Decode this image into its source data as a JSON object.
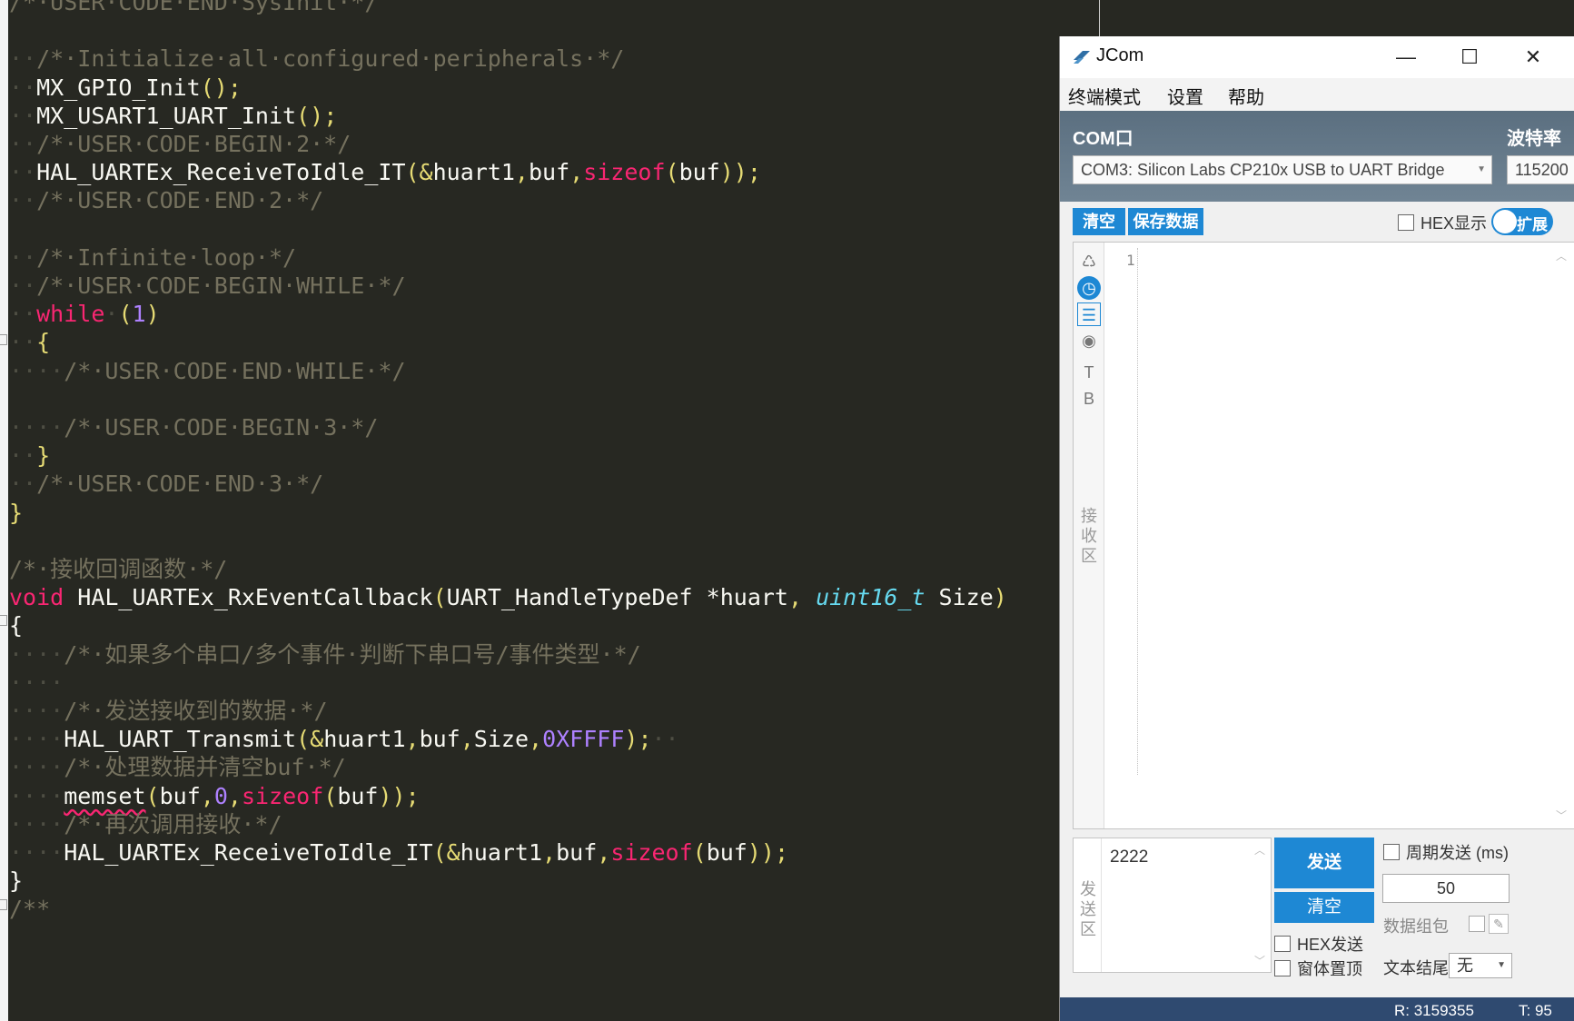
{
  "editor": {
    "lines": [
      [
        {
          "t": "/*·USER·CODE·END·SysInit·*/",
          "c": "comment"
        }
      ],
      [],
      [
        {
          "t": "··",
          "c": "ws"
        },
        {
          "t": "/*·Initialize·all·configured·peripherals·*/",
          "c": "comment"
        }
      ],
      [
        {
          "t": "··",
          "c": "ws"
        },
        {
          "t": "MX_GPIO_Init",
          "c": "plain"
        },
        {
          "t": "();",
          "c": "paren"
        }
      ],
      [
        {
          "t": "··",
          "c": "ws"
        },
        {
          "t": "MX_USART1_UART_Init",
          "c": "plain"
        },
        {
          "t": "();",
          "c": "paren"
        }
      ],
      [
        {
          "t": "··",
          "c": "ws"
        },
        {
          "t": "/*·USER·CODE·BEGIN·2·*/",
          "c": "comment"
        }
      ],
      [
        {
          "t": "··",
          "c": "ws"
        },
        {
          "t": "HAL_UARTEx_ReceiveToIdle_IT",
          "c": "plain"
        },
        {
          "t": "(&",
          "c": "paren"
        },
        {
          "t": "huart1",
          "c": "plain"
        },
        {
          "t": ",",
          "c": "paren"
        },
        {
          "t": "buf",
          "c": "plain"
        },
        {
          "t": ",",
          "c": "paren"
        },
        {
          "t": "sizeof",
          "c": "keyword"
        },
        {
          "t": "(",
          "c": "paren"
        },
        {
          "t": "buf",
          "c": "plain"
        },
        {
          "t": "));",
          "c": "paren"
        }
      ],
      [
        {
          "t": "··",
          "c": "ws"
        },
        {
          "t": "/*·USER·CODE·END·2·*/",
          "c": "comment"
        }
      ],
      [],
      [
        {
          "t": "··",
          "c": "ws"
        },
        {
          "t": "/*·Infinite·loop·*/",
          "c": "comment"
        }
      ],
      [
        {
          "t": "··",
          "c": "ws"
        },
        {
          "t": "/*·USER·CODE·BEGIN·WHILE·*/",
          "c": "comment"
        }
      ],
      [
        {
          "t": "··",
          "c": "ws"
        },
        {
          "t": "while",
          "c": "keyword"
        },
        {
          "t": "·",
          "c": "ws"
        },
        {
          "t": "(",
          "c": "paren"
        },
        {
          "t": "1",
          "c": "number"
        },
        {
          "t": ")",
          "c": "paren"
        }
      ],
      [
        {
          "t": "··",
          "c": "ws"
        },
        {
          "t": "{",
          "c": "paren"
        }
      ],
      [
        {
          "t": "····",
          "c": "ws"
        },
        {
          "t": "/*·USER·CODE·END·WHILE·*/",
          "c": "comment"
        }
      ],
      [],
      [
        {
          "t": "····",
          "c": "ws"
        },
        {
          "t": "/*·USER·CODE·BEGIN·3·*/",
          "c": "comment"
        }
      ],
      [
        {
          "t": "··",
          "c": "ws"
        },
        {
          "t": "}",
          "c": "paren"
        }
      ],
      [
        {
          "t": "··",
          "c": "ws"
        },
        {
          "t": "/*·USER·CODE·END·3·*/",
          "c": "comment"
        }
      ],
      [
        {
          "t": "}",
          "c": "paren"
        }
      ],
      [],
      [
        {
          "t": "/*·接收回调函数·*/",
          "c": "comment"
        }
      ],
      [
        {
          "t": "void",
          "c": "keyword"
        },
        {
          "t": " HAL_UARTEx_RxEventCallback",
          "c": "plain"
        },
        {
          "t": "(",
          "c": "paren"
        },
        {
          "t": "UART_HandleTypeDef",
          "c": "plain"
        },
        {
          "t": " *huart",
          "c": "plain"
        },
        {
          "t": ", ",
          "c": "paren"
        },
        {
          "t": "uint16_t",
          "c": "type"
        },
        {
          "t": " Size",
          "c": "plain"
        },
        {
          "t": ")",
          "c": "paren"
        }
      ],
      [
        {
          "t": "{",
          "c": "plain"
        }
      ],
      [
        {
          "t": "····",
          "c": "ws"
        },
        {
          "t": "/*·如果多个串口/多个事件·判断下串口号/事件类型·*/",
          "c": "comment"
        }
      ],
      [
        {
          "t": "····",
          "c": "ws"
        }
      ],
      [
        {
          "t": "····",
          "c": "ws"
        },
        {
          "t": "/*·发送接收到的数据·*/",
          "c": "comment"
        }
      ],
      [
        {
          "t": "····",
          "c": "ws"
        },
        {
          "t": "HAL_UART_Transmit",
          "c": "plain"
        },
        {
          "t": "(&",
          "c": "paren"
        },
        {
          "t": "huart1",
          "c": "plain"
        },
        {
          "t": ",",
          "c": "paren"
        },
        {
          "t": "buf",
          "c": "plain"
        },
        {
          "t": ",",
          "c": "paren"
        },
        {
          "t": "Size",
          "c": "plain"
        },
        {
          "t": ",",
          "c": "paren"
        },
        {
          "t": "0XFFFF",
          "c": "number"
        },
        {
          "t": ");",
          "c": "paren"
        },
        {
          "t": "··",
          "c": "ws"
        }
      ],
      [
        {
          "t": "····",
          "c": "ws"
        },
        {
          "t": "/*·处理数据并清空buf·*/",
          "c": "comment"
        }
      ],
      [
        {
          "t": "····",
          "c": "ws"
        },
        {
          "t": "memset",
          "c": "squiggle"
        },
        {
          "t": "(",
          "c": "paren"
        },
        {
          "t": "buf",
          "c": "plain"
        },
        {
          "t": ",",
          "c": "paren"
        },
        {
          "t": "0",
          "c": "number"
        },
        {
          "t": ",",
          "c": "paren"
        },
        {
          "t": "sizeof",
          "c": "keyword"
        },
        {
          "t": "(",
          "c": "paren"
        },
        {
          "t": "buf",
          "c": "plain"
        },
        {
          "t": "));",
          "c": "paren"
        }
      ],
      [
        {
          "t": "····",
          "c": "ws"
        },
        {
          "t": "/*·再次调用接收·*/",
          "c": "comment"
        }
      ],
      [
        {
          "t": "····",
          "c": "ws"
        },
        {
          "t": "HAL_UARTEx_ReceiveToIdle_IT",
          "c": "plain"
        },
        {
          "t": "(&",
          "c": "paren"
        },
        {
          "t": "huart1",
          "c": "plain"
        },
        {
          "t": ",",
          "c": "paren"
        },
        {
          "t": "buf",
          "c": "plain"
        },
        {
          "t": ",",
          "c": "paren"
        },
        {
          "t": "sizeof",
          "c": "keyword"
        },
        {
          "t": "(",
          "c": "paren"
        },
        {
          "t": "buf",
          "c": "plain"
        },
        {
          "t": "));",
          "c": "paren"
        }
      ],
      [
        {
          "t": "}",
          "c": "plain"
        }
      ],
      [
        {
          "t": "/**",
          "c": "comment"
        }
      ]
    ]
  },
  "jcom": {
    "title": "JCom",
    "window_controls": {
      "minimize": "—",
      "maximize": "☐",
      "close": "✕"
    },
    "menu": [
      "终端模式",
      "设置",
      "帮助"
    ],
    "com_label": "COM口",
    "baud_label": "波特率",
    "com_port": "COM3:  Silicon Labs CP210x USB to UART Bridge",
    "baud_rate": "115200",
    "receive": {
      "clear_label": "清空",
      "save_label": "保存数据",
      "hex_display_label": "HEX显示",
      "expand_label": "扩展",
      "side_label": "接收区",
      "line_number": "1",
      "tools": [
        {
          "icon": "recycle-icon",
          "glyph": "♺"
        },
        {
          "icon": "clock-icon",
          "glyph": "◷"
        },
        {
          "icon": "list-icon",
          "glyph": "☰"
        },
        {
          "icon": "eye-icon",
          "glyph": "◉"
        },
        {
          "icon": "text-icon",
          "glyph": "T"
        },
        {
          "icon": "bold-icon",
          "glyph": "B"
        }
      ]
    },
    "send": {
      "side_label": "发送区",
      "value": "2222",
      "send_label": "发送",
      "clear_label": "清空",
      "hex_send_label": "HEX发送",
      "on_top_label": "窗体置顶",
      "periodic_label": "周期发送 (ms)",
      "period_value": "50",
      "packet_label": "数据组包",
      "eol_label": "文本结尾",
      "eol_value": "无"
    },
    "status": {
      "rx": "R: 3159355",
      "tx": "T: 95"
    },
    "colors": {
      "accent": "#1e88d4",
      "status_bar": "#2f4a70"
    }
  }
}
